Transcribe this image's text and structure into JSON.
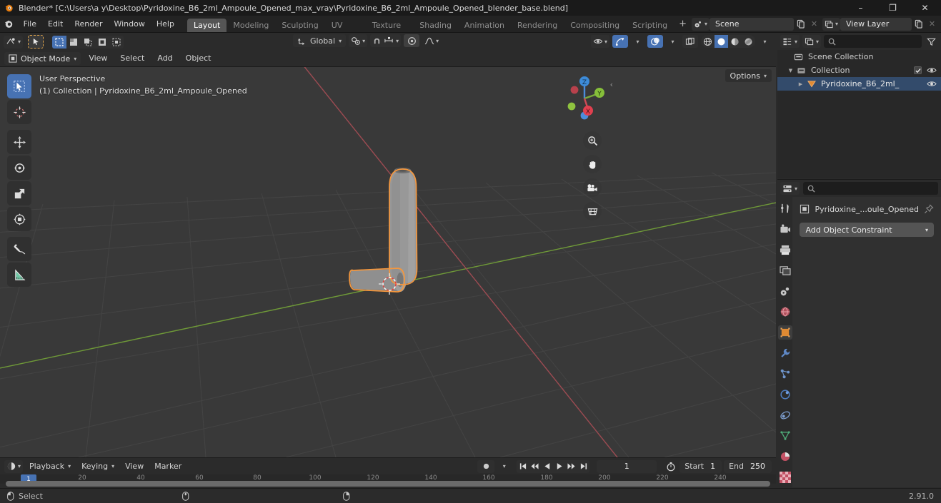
{
  "window": {
    "title": "Blender* [C:\\Users\\a y\\Desktop\\Pyridoxine_B6_2ml_Ampoule_Opened_max_vray\\Pyridoxine_B6_2ml_Ampoule_Opened_blender_base.blend]",
    "minimize": "–",
    "maximize": "❐",
    "close": "✕"
  },
  "topbar": {
    "menus": [
      "File",
      "Edit",
      "Render",
      "Window",
      "Help"
    ],
    "workspaces": [
      {
        "label": "Layout",
        "active": true
      },
      {
        "label": "Modeling",
        "active": false
      },
      {
        "label": "Sculpting",
        "active": false
      },
      {
        "label": "UV Editing",
        "active": false
      },
      {
        "label": "Texture Paint",
        "active": false
      },
      {
        "label": "Shading",
        "active": false
      },
      {
        "label": "Animation",
        "active": false
      },
      {
        "label": "Rendering",
        "active": false
      },
      {
        "label": "Compositing",
        "active": false
      },
      {
        "label": "Scripting",
        "active": false
      }
    ],
    "add_workspace": "+",
    "scene_name": "Scene",
    "view_layer_name": "View Layer"
  },
  "viewport": {
    "mode": "Object Mode",
    "menus": [
      "View",
      "Select",
      "Add",
      "Object"
    ],
    "transform_orientation": "Global",
    "options_label": "Options",
    "overlay_line1": "User Perspective",
    "overlay_line2": "(1) Collection | Pyridoxine_B6_2ml_Ampoule_Opened",
    "collapse_arrow": "‹",
    "gizmo_axes": {
      "x": "X",
      "y": "Y",
      "z": "Z"
    },
    "toolbar": [
      {
        "name": "tweak-select-box-tool",
        "active": true
      },
      {
        "name": "cursor-tool",
        "active": false
      },
      {
        "name": "move-tool",
        "active": false
      },
      {
        "name": "rotate-tool",
        "active": false
      },
      {
        "name": "scale-tool",
        "active": false
      },
      {
        "name": "transform-tool",
        "active": false
      },
      {
        "name": "annotate-tool",
        "active": false
      },
      {
        "name": "measure-tool",
        "active": false
      }
    ],
    "nav_icons": [
      "zoom-icon",
      "pan-hand-icon",
      "camera-view-icon",
      "orthographic-toggle-icon"
    ],
    "object_color": "#9a9a9a",
    "selection_outline_color": "#f5973d",
    "grid_color": "#4c4c4c",
    "background_color": "#393939",
    "x_axis_color": "#9c4a4f",
    "y_axis_color": "#6b9a36"
  },
  "outliner": {
    "search_placeholder": "",
    "rows": [
      {
        "label": "Scene Collection",
        "indent": 0,
        "icon": "collection-icon",
        "has_tri": false,
        "expanded": false,
        "selected": false,
        "checkbox": false,
        "eye": false
      },
      {
        "label": "Collection",
        "indent": 1,
        "icon": "collection-icon",
        "has_tri": true,
        "expanded": true,
        "selected": false,
        "checkbox": true,
        "eye": true
      },
      {
        "label": "Pyridoxine_B6_2ml_",
        "indent": 2,
        "icon": "mesh-object-icon",
        "has_tri": true,
        "expanded": false,
        "selected": true,
        "checkbox": false,
        "eye": true
      }
    ]
  },
  "properties": {
    "breadcrumb_object": "Pyridoxine_...oule_Opened",
    "add_constraint_label": "Add Object Constraint",
    "search_placeholder": "",
    "tabs": [
      {
        "name": "tool-tab",
        "active": false
      },
      {
        "name": "render-tab",
        "active": false
      },
      {
        "name": "output-tab",
        "active": false
      },
      {
        "name": "view-layer-tab",
        "active": false
      },
      {
        "name": "scene-tab",
        "active": false
      },
      {
        "name": "world-tab",
        "active": false
      },
      {
        "name": "object-tab",
        "active": true
      },
      {
        "name": "modifier-tab",
        "active": false
      },
      {
        "name": "particles-tab",
        "active": false
      },
      {
        "name": "physics-tab",
        "active": false
      },
      {
        "name": "constraint-tab",
        "active": false
      },
      {
        "name": "object-data-tab",
        "active": false
      },
      {
        "name": "material-tab",
        "active": false
      },
      {
        "name": "texture-tab",
        "active": false
      }
    ]
  },
  "timeline": {
    "menus": [
      "Playback",
      "Keying",
      "View",
      "Marker"
    ],
    "current_frame": "1",
    "start_label": "Start",
    "start_value": "1",
    "end_label": "End",
    "end_value": "250",
    "ruler_ticks": [
      "20",
      "40",
      "60",
      "80",
      "100",
      "120",
      "140",
      "160",
      "180",
      "200",
      "220",
      "240"
    ],
    "playhead_label": "1"
  },
  "statusbar": {
    "select_label": "Select",
    "version": "2.91.0"
  }
}
